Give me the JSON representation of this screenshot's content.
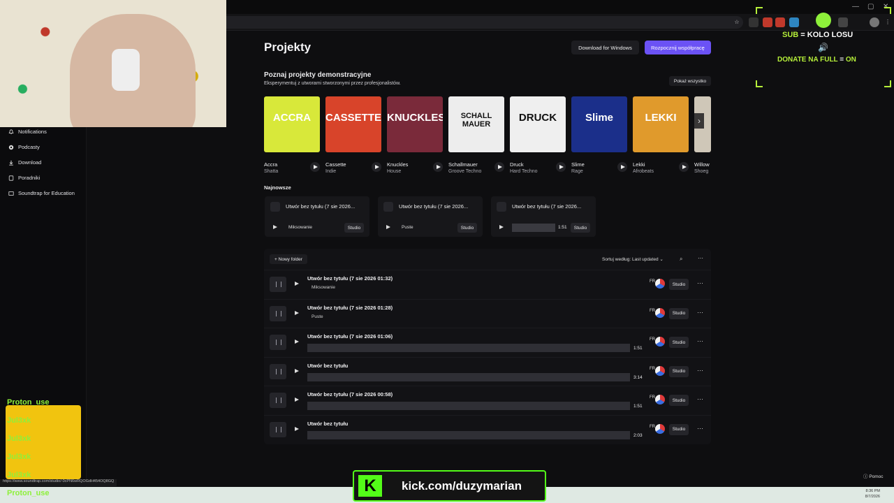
{
  "page": {
    "title": "Projekty",
    "download_btn": "Download for Windows",
    "collab_btn": "Rozpocznij współpracę",
    "help": "Pomoc"
  },
  "sidebar": {
    "items": [
      {
        "label": "Notifications",
        "icon": "bell-icon"
      },
      {
        "label": "Podcasty",
        "icon": "podcast-icon"
      },
      {
        "label": "Download",
        "icon": "download-icon"
      },
      {
        "label": "Poradniki",
        "icon": "book-icon"
      },
      {
        "label": "Soundtrap for Education",
        "icon": "education-icon"
      }
    ]
  },
  "demos": {
    "title": "Poznaj projekty demonstracyjne",
    "subtitle": "Eksperymentuj z utworami stworzonymi przez profesjonalistów.",
    "show_all": "Pokaż wszystko",
    "items": [
      {
        "name": "Accra",
        "genre": "Shatta",
        "cover": "ACCRA",
        "color": "#d8e83a"
      },
      {
        "name": "Cassette",
        "genre": "Indie",
        "cover": "CASSETTE",
        "color": "#d8442a"
      },
      {
        "name": "Knuckles",
        "genre": "House",
        "cover": "KNUCKLES",
        "color": "#7a2a3a"
      },
      {
        "name": "Schallmauer",
        "genre": "Groove Techno",
        "cover": "SCHALL MAUER",
        "color": "#ededed"
      },
      {
        "name": "Druck",
        "genre": "Hard Techno",
        "cover": "DRUCK",
        "color": "#efefef"
      },
      {
        "name": "Slime",
        "genre": "Rage",
        "cover": "Slime",
        "color": "#1b2f8a"
      },
      {
        "name": "Lekki",
        "genre": "Afrobeats",
        "cover": "LEKKI",
        "color": "#e09a2c"
      },
      {
        "name": "Willow",
        "genre": "Shoeg",
        "cover": "",
        "color": "#cfc7b8"
      }
    ]
  },
  "newest": {
    "title": "Najnowsze",
    "items": [
      {
        "title": "Utwór bez tytułu (7 sie 2026...",
        "status": "Miksowanie",
        "studio": "Studio"
      },
      {
        "title": "Utwór bez tytułu (7 sie 2026...",
        "status": "Puste",
        "studio": "Studio"
      },
      {
        "title": "Utwór bez tytułu (7 sie 2026...",
        "duration": "1:51",
        "studio": "Studio"
      }
    ]
  },
  "projects": {
    "new_folder": "+ Nowy folder",
    "sort_label": "Sortuj według: Last updated",
    "rows": [
      {
        "title": "Utwór bez tytułu (7 sie 2026 01:32)",
        "sub": "Miksowanie",
        "duration": "",
        "studio": "Studio",
        "owner": "FR"
      },
      {
        "title": "Utwór bez tytułu (7 sie 2026 01:28)",
        "sub": "Puste",
        "duration": "",
        "studio": "Studio",
        "owner": "FR"
      },
      {
        "title": "Utwór bez tytułu (7 sie 2026 01:06)",
        "sub": "",
        "duration": "1:51",
        "studio": "Studio",
        "owner": "FR"
      },
      {
        "title": "Utwór bez tytułu",
        "sub": "",
        "duration": "3:14",
        "studio": "Studio",
        "owner": "FR"
      },
      {
        "title": "Utwór bez tytułu (7 sie 2026 00:58)",
        "sub": "",
        "duration": "1:51",
        "studio": "Studio",
        "owner": "FR"
      },
      {
        "title": "Utwór bez tytułu",
        "sub": "",
        "duration": "2:03",
        "studio": "Studio",
        "owner": "FR"
      }
    ]
  },
  "status_url": "https://www.soundtrap.com/studio/-0cPN6wRQOGdH454OQ8GQ",
  "overlay": {
    "sub_a": "SUB",
    "sub_eq": " = ",
    "sub_b": "KOLO LOSU",
    "donate_a": "DONATE NA FULL",
    "donate_eq": " = ",
    "donate_b": "ON",
    "kick": "kick.com/duzymarian",
    "chat": [
      "Proton_use",
      "Jul3xk",
      "Jul3xk",
      "Jul3xk",
      "Jul3xk"
    ],
    "taskbar_chat": "Proton_use",
    "taskbar_time": "8:36 PM",
    "taskbar_date": "8/7/2026"
  }
}
